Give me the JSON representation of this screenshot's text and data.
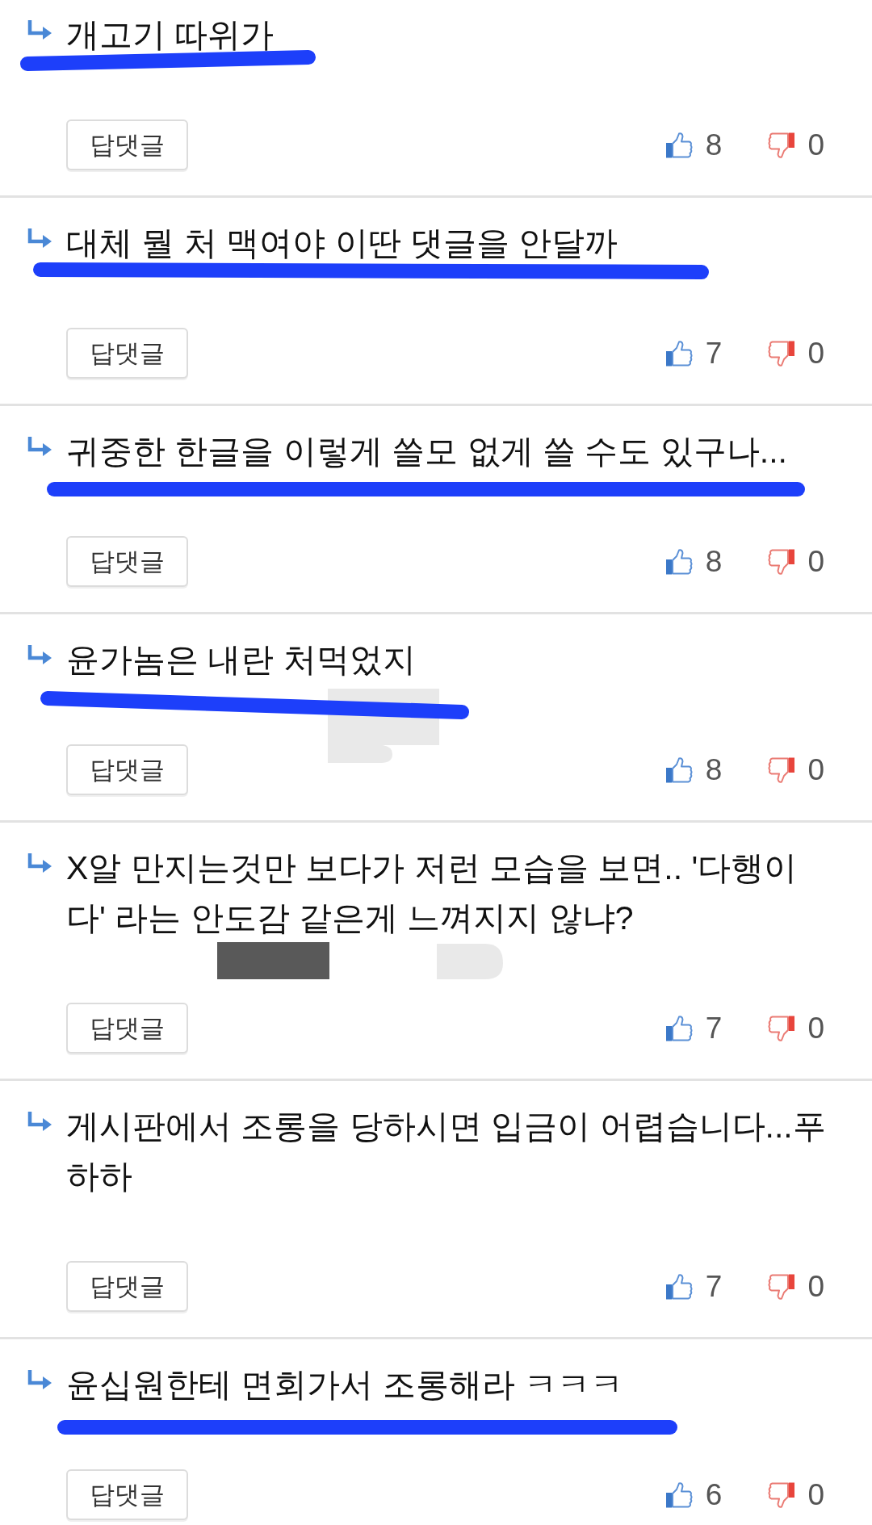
{
  "comments": [
    {
      "text": "개고기 따위가",
      "highlighted": true,
      "reply_button": "답댓글",
      "likes": "8",
      "dislikes": "0"
    },
    {
      "text": "대체 뭘 처 맥여야 이딴 댓글을 안달까",
      "highlighted": true,
      "reply_button": "답댓글",
      "likes": "7",
      "dislikes": "0"
    },
    {
      "text": "귀중한 한글을 이렇게 쓸모 없게 쓸 수도 있구나...",
      "highlighted": true,
      "reply_button": "답댓글",
      "likes": "8",
      "dislikes": "0"
    },
    {
      "text": "윤가놈은 내란 처먹었지",
      "highlighted": true,
      "redaction_marks": [
        {
          "kind": "light"
        }
      ],
      "reply_button": "답댓글",
      "likes": "8",
      "dislikes": "0"
    },
    {
      "text": "X알 만지는것만 보다가 저런 모습을 보면.. '다행이다' 라는 안도감 같은게 느껴지지 않냐?",
      "highlighted": false,
      "redaction_marks": [
        {
          "kind": "dark"
        },
        {
          "kind": "light"
        }
      ],
      "reply_button": "답댓글",
      "likes": "7",
      "dislikes": "0"
    },
    {
      "text": "게시판에서 조롱을 당하시면 입금이 어렵습니다...푸하하",
      "highlighted": false,
      "reply_button": "답댓글",
      "likes": "7",
      "dislikes": "0"
    },
    {
      "text": "윤십원한테 면회가서 조롱해라 ㅋㅋㅋ",
      "highlighted": true,
      "reply_button": "답댓글",
      "likes": "6",
      "dislikes": "0"
    }
  ]
}
